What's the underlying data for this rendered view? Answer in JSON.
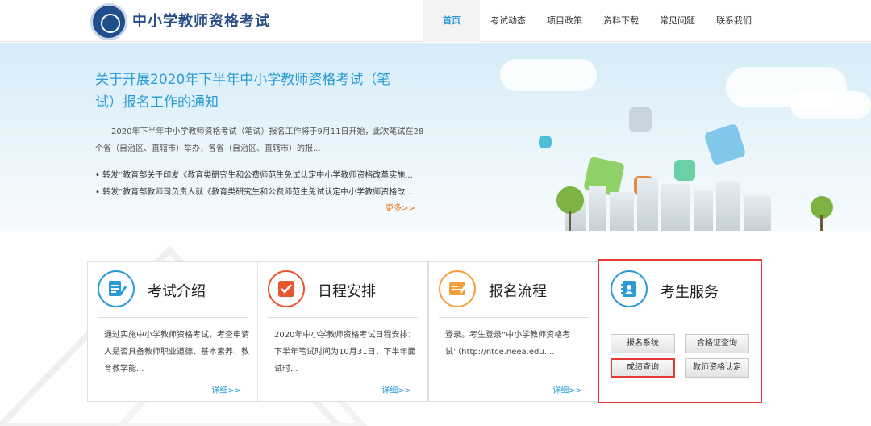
{
  "header": {
    "site_title": "中小学教师资格考试",
    "nav": [
      "首页",
      "考试动态",
      "项目政策",
      "资料下载",
      "常见问题",
      "联系我们"
    ],
    "active_color": "#2a9bd6"
  },
  "banner": {
    "title": "关于开展2020年下半年中小学教师资格考试（笔试）报名工作的通知",
    "description": "2020年下半年中小学教师资格考试（笔试）报名工作将于9月11日开始，此次笔试在28个省（自治区、直辖市）举办，各省（自治区、直辖市）的报...",
    "links": [
      "• 转发“教育部关于印发《教育类研究生和公费师范生免试认定中小学教师资格改革实施...",
      "• 转发“教育部教师司负责人就《教育类研究生和公费师范生免试认定中小学教师资格改..."
    ],
    "more_label": "更多>>"
  },
  "cards": [
    {
      "title": "考试介绍",
      "text": "通过实施中小学教师资格考试，考查申请人是否具备教师职业道德、基本素养、教育教学能...",
      "more": "详细>>",
      "icon": "document-edit-icon",
      "color": "#2a9bd6"
    },
    {
      "title": "日程安排",
      "text": "2020年中小学教师资格考试日程安排：下半年笔试时间为10月31日，下半年面试时...",
      "more": "详细>>",
      "icon": "checkmark-icon",
      "color": "#e8552e"
    },
    {
      "title": "报名流程",
      "text": "登录。考生登录“中小学教师资格考试”（http://ntce.neea.edu....",
      "more": "详细>>",
      "icon": "form-icon",
      "color": "#f2a03d"
    }
  ],
  "service": {
    "title": "考生服务",
    "icon": "contact-book-icon",
    "buttons": [
      "报名系统",
      "合格证查询",
      "成绩查询",
      "教师资格认定"
    ],
    "highlight_color": "#e53935"
  }
}
